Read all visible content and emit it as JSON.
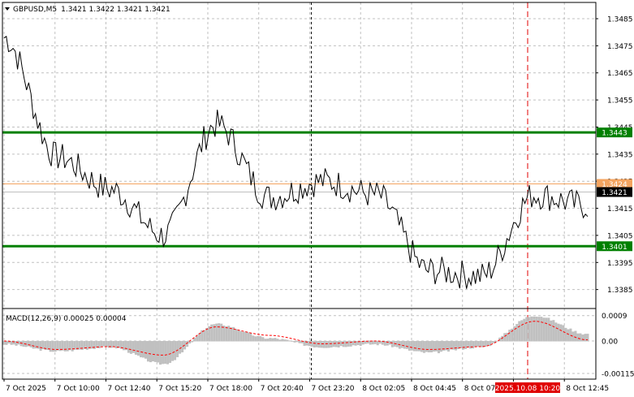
{
  "header": {
    "symbol": "GBPUSD,M5",
    "ohlc": "1.3421 1.3422 1.3421 1.3421"
  },
  "indicator": {
    "label": "MACD(12,26,9) 0.00025 0.00004"
  },
  "colors": {
    "background": "#ffffff",
    "price_line": "#000000",
    "grid": "#c0c0c0",
    "support_resistance": "#008000",
    "bid_line": "#c0c0c0",
    "ask_line": "#f4a460",
    "current_time_line": "#e00000",
    "macd_histogram": "#c0c0c0",
    "signal_line": "#ff0000",
    "tag_bg": "#000000",
    "tag_text": "#ffffff",
    "time_highlight_bg": "#e00000"
  },
  "chart_data": [
    {
      "type": "line",
      "title": "GBPUSD,M5",
      "ylim": [
        1.3378,
        1.3491
      ],
      "y_ticks": [
        "1.3485",
        "1.3475",
        "1.3465",
        "1.3455",
        "1.3445",
        "1.3435",
        "1.3425",
        "1.3415",
        "1.3405",
        "1.3395",
        "1.3385"
      ],
      "x_ticks": [
        "7 Oct 2025",
        "7 Oct 10:00",
        "7 Oct 12:40",
        "7 Oct 15:20",
        "7 Oct 18:00",
        "7 Oct 20:40",
        "7 Oct 23:20",
        "8 Oct 02:05",
        "8 Oct 04:45",
        "8 Oct 07:25",
        "8 Oct 10:20",
        "8 Oct 12:45"
      ],
      "highlighted_time": "2025.10.08 10:20",
      "session_separator_at": "7 Oct 23:20",
      "x": [
        "7 Oct 2025",
        "7 Oct 10:00",
        "7 Oct 12:40",
        "7 Oct 15:20",
        "7 Oct 18:00",
        "7 Oct 20:40",
        "7 Oct 23:20",
        "8 Oct 02:05",
        "8 Oct 04:45",
        "8 Oct 07:25",
        "8 Oct 10:20",
        "8 Oct 12:45"
      ],
      "series": [
        {
          "values": [
            1.3478,
            1.3434,
            1.3422,
            1.3405,
            1.3446,
            1.3419,
            1.3425,
            1.342,
            1.3392,
            1.339,
            1.342,
            1.3416
          ]
        }
      ],
      "levels": [
        {
          "label": "1.3443",
          "value": 1.3443,
          "kind": "green"
        },
        {
          "label": "1.3401",
          "value": 1.3401,
          "kind": "green"
        },
        {
          "label": "1.3424",
          "value": 1.3424,
          "kind": "ask"
        },
        {
          "label": "1.3421",
          "value": 1.3421,
          "kind": "bid"
        }
      ]
    },
    {
      "type": "bar",
      "title": "MACD(12,26,9)",
      "ylim": [
        -0.00135,
        0.00115
      ],
      "y_ticks": [
        "0.0009",
        "0.00",
        "-0.00115"
      ],
      "x": [
        "7 Oct 2025",
        "7 Oct 10:00",
        "7 Oct 12:40",
        "7 Oct 15:20",
        "7 Oct 18:00",
        "7 Oct 20:40",
        "7 Oct 23:20",
        "8 Oct 02:05",
        "8 Oct 04:45",
        "8 Oct 07:25",
        "8 Oct 10:20",
        "8 Oct 12:45"
      ],
      "series": [
        {
          "name": "MACD",
          "values": [
            -0.0001,
            -0.00035,
            -0.0002,
            -0.0008,
            0.0006,
            0.0001,
            -0.0002,
            -0.0001,
            -0.0004,
            -0.0002,
            0.0009,
            0.00025
          ]
        },
        {
          "name": "Signal",
          "values": [
            0.0,
            -0.0003,
            -0.0002,
            -0.0005,
            0.0005,
            0.0002,
            -0.0001,
            0.0,
            -0.0003,
            -0.0002,
            0.0007,
            4e-05
          ]
        }
      ]
    }
  ]
}
